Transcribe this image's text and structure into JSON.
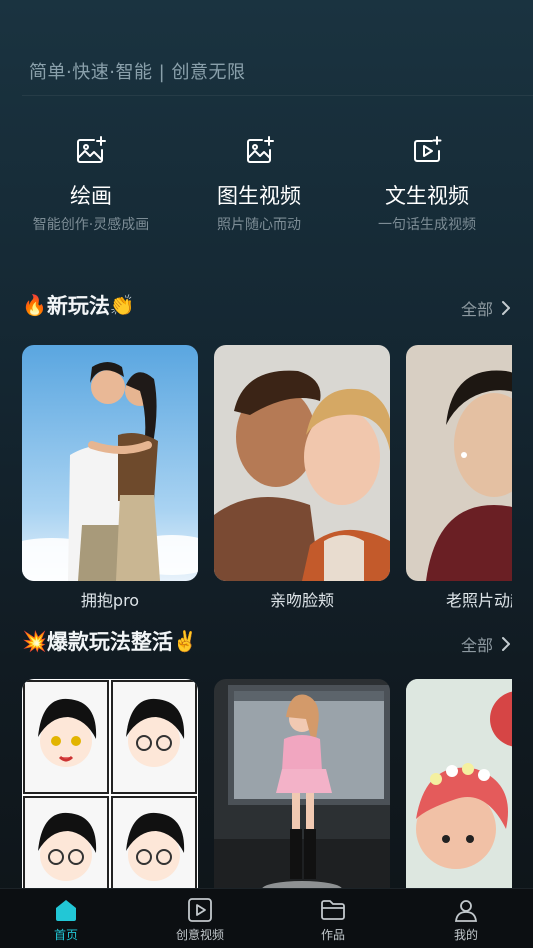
{
  "header": {
    "tagline": "简单·快速·智能  |  创意无限"
  },
  "tools": [
    {
      "name": "绘画",
      "desc": "智能创作·灵感成画",
      "icon": "image-sparkle-icon"
    },
    {
      "name": "图生视频",
      "desc": "照片随心而动",
      "icon": "image-sparkle-icon"
    },
    {
      "name": "文生视频",
      "desc": "一句话生成视频",
      "icon": "video-sparkle-icon"
    }
  ],
  "sections": [
    {
      "title": "新玩法",
      "emoji_left": "🔥",
      "emoji_right": "👏",
      "see_all": "全部",
      "items": [
        {
          "label": "拥抱pro"
        },
        {
          "label": "亲吻脸颊"
        },
        {
          "label": "老照片动起来"
        }
      ]
    },
    {
      "title": "爆款玩法整活",
      "emoji_left": "💥",
      "emoji_right": "✌️",
      "see_all": "全部",
      "items": [
        {
          "label": ""
        },
        {
          "label": ""
        },
        {
          "label": ""
        }
      ]
    }
  ],
  "bottom_nav": [
    {
      "label": "首页",
      "icon": "home-icon",
      "active": true
    },
    {
      "label": "创意视频",
      "icon": "play-icon",
      "active": false
    },
    {
      "label": "作品",
      "icon": "folder-icon",
      "active": false
    },
    {
      "label": "我的",
      "icon": "user-icon",
      "active": false
    }
  ],
  "colors": {
    "accent": "#22c7d6",
    "background_top": "#1a3340",
    "background_bottom": "#0e1418"
  }
}
